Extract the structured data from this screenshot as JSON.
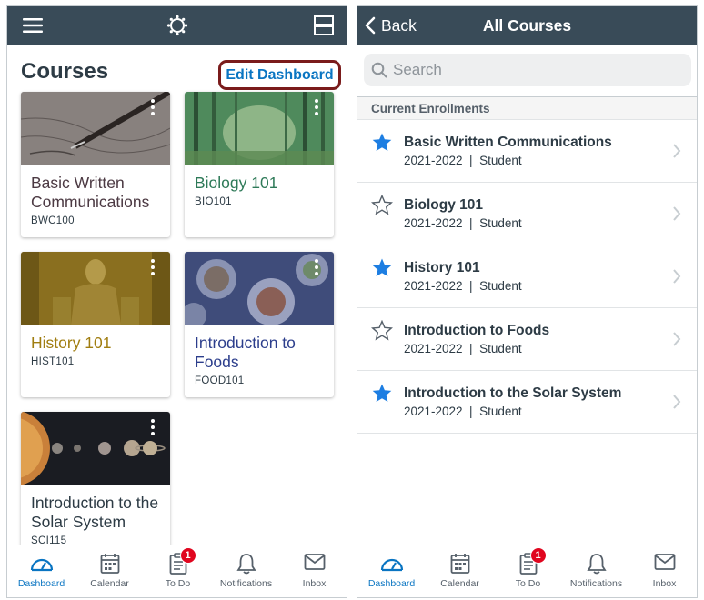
{
  "left_screen": {
    "title": "Courses",
    "edit_dashboard_label": "Edit Dashboard",
    "cards": [
      {
        "name": "Basic Written Communications",
        "code": "BWC100",
        "color": "#4c3a43",
        "image": "pen-writing"
      },
      {
        "name": "Biology 101",
        "code": "BIO101",
        "color": "#2e7a58",
        "image": "forest"
      },
      {
        "name": "History 101",
        "code": "HIST101",
        "color": "#a07d10",
        "image": "lincoln-statue"
      },
      {
        "name": "Introduction to Foods",
        "code": "FOOD101",
        "color": "#2c3e8c",
        "image": "food-plates"
      },
      {
        "name": "Introduction to the Solar System",
        "code": "SCI115",
        "color": "#2d3b45",
        "image": "planets"
      }
    ]
  },
  "right_screen": {
    "back_label": "Back",
    "title": "All Courses",
    "search_placeholder": "Search",
    "section_header": "Current Enrollments",
    "courses": [
      {
        "name": "Basic Written Communications",
        "subtitle": "2021-2022  |  Student",
        "favorite": true
      },
      {
        "name": "Biology 101",
        "subtitle": "2021-2022  |  Student",
        "favorite": false
      },
      {
        "name": "History 101",
        "subtitle": "2021-2022  |  Student",
        "favorite": true
      },
      {
        "name": "Introduction to Foods",
        "subtitle": "2021-2022  |  Student",
        "favorite": false
      },
      {
        "name": "Introduction to the Solar System",
        "subtitle": "2021-2022  |  Student",
        "favorite": true
      }
    ]
  },
  "tab_bar": {
    "tabs": [
      {
        "label": "Dashboard",
        "icon": "dashboard-icon",
        "active": true
      },
      {
        "label": "Calendar",
        "icon": "calendar-icon",
        "active": false
      },
      {
        "label": "To Do",
        "icon": "todo-icon",
        "active": false,
        "badge": "1"
      },
      {
        "label": "Notifications",
        "icon": "bell-icon",
        "active": false
      },
      {
        "label": "Inbox",
        "icon": "inbox-icon",
        "active": false
      }
    ]
  },
  "colors": {
    "nav_bar": "#394b58",
    "accent": "#0a75c2",
    "star": "#1d7ee2",
    "badge": "#e0061f",
    "highlight_border": "#7a1b1b"
  }
}
